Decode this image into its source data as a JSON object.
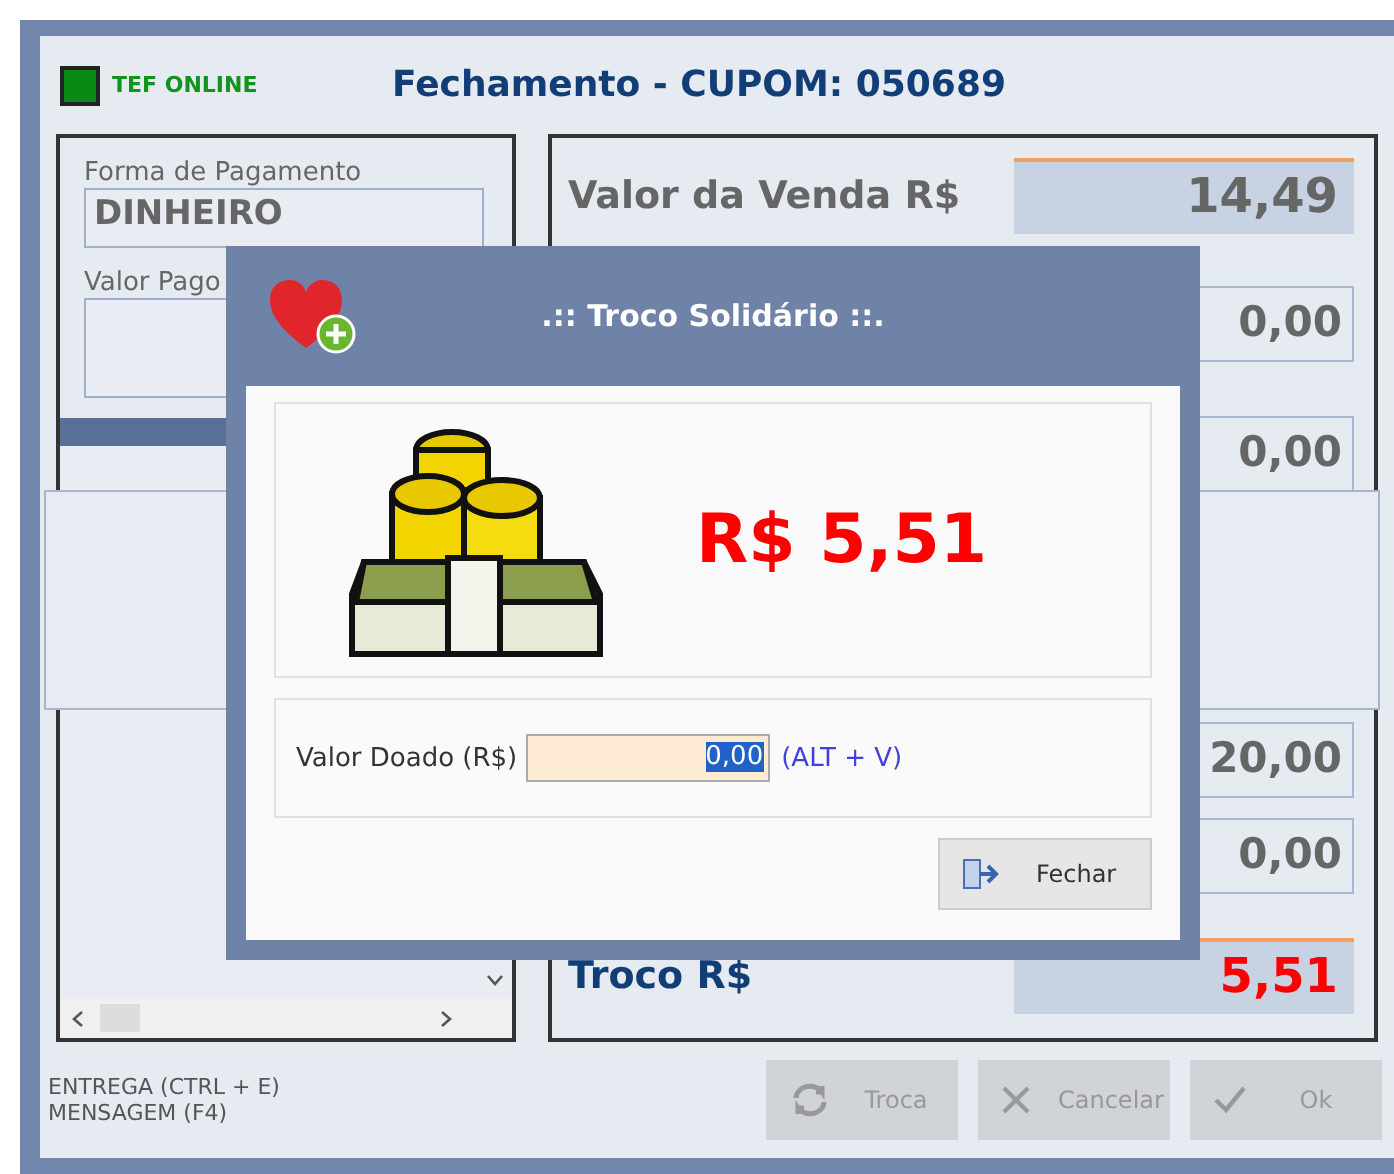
{
  "window": {
    "status": {
      "label": "TEF ONLINE",
      "on": true
    },
    "title": "Fechamento - CUPOM: 050689"
  },
  "payment": {
    "method_label": "Forma de Pagamento",
    "method": "DINHEIRO",
    "paid_label": "Valor Pago"
  },
  "totals": [
    {
      "kind": "sale",
      "label": "Valor da Venda R$",
      "value": "14,49"
    },
    {
      "kind": "plain",
      "value": "0,00"
    },
    {
      "kind": "plain",
      "value": "0,00"
    },
    {
      "kind": "plain",
      "value": "20,00"
    },
    {
      "kind": "plain",
      "value": "0,00"
    },
    {
      "kind": "change",
      "label": "Troco R$",
      "value": "5,51"
    }
  ],
  "footer": {
    "shortcuts": [
      "ENTREGA (CTRL + E)",
      "MENSAGEM (F4)"
    ],
    "buttons": [
      {
        "kind": "swap",
        "label": "Troca",
        "disabled": true
      },
      {
        "kind": "cancel",
        "label": "Cancelar",
        "disabled": true
      },
      {
        "kind": "ok",
        "label": "Ok",
        "disabled": true
      }
    ]
  },
  "dialog": {
    "title": ".:: Troco Solidário ::.",
    "amount": "R$ 5,51",
    "field_label": "Valor Doado (R$)",
    "field_value": "0,00",
    "hint": "(ALT + V)",
    "close_button": "Fechar"
  }
}
